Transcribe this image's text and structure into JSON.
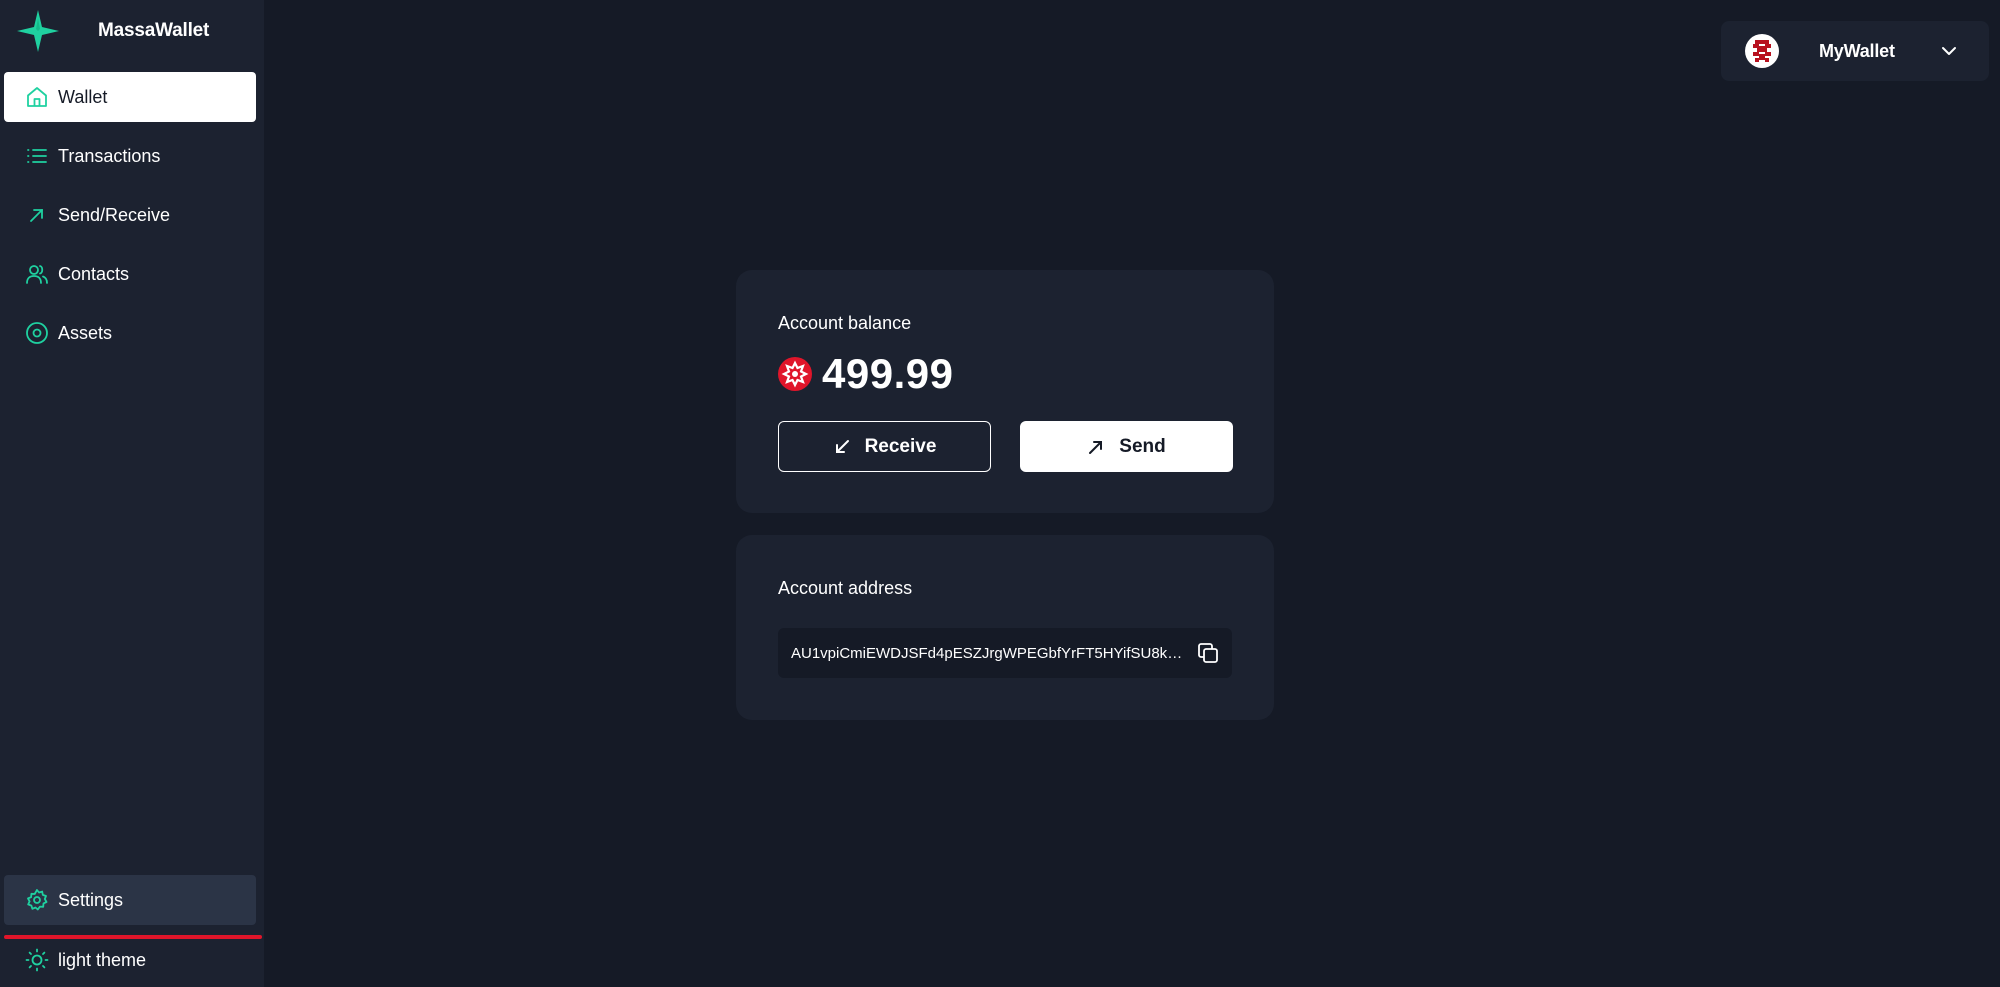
{
  "brand": {
    "name": "MassaWallet",
    "icon": "massa-star-icon",
    "accent": "#1fd1a0"
  },
  "sidebar": {
    "items": [
      {
        "label": "Wallet",
        "icon": "home-icon",
        "active": true
      },
      {
        "label": "Transactions",
        "icon": "list-icon"
      },
      {
        "label": "Send/Receive",
        "icon": "arrow-up-right-icon"
      },
      {
        "label": "Contacts",
        "icon": "users-icon"
      },
      {
        "label": "Assets",
        "icon": "target-icon"
      }
    ],
    "settings_label": "Settings",
    "theme_label": "light theme"
  },
  "account": {
    "name": "MyWallet",
    "avatar": "pixel-avatar-icon"
  },
  "balance": {
    "label": "Account balance",
    "value": "499.99",
    "coin_icon": "massa-coin-icon",
    "receive_label": "Receive",
    "send_label": "Send"
  },
  "address": {
    "label": "Account address",
    "value": "AU1vpiCmiEWDJSFd4pESZJrgWPEGbfYrFT5HYifSU8ko5..."
  },
  "colors": {
    "background": "#151a26",
    "panel": "#1c2230",
    "accent": "#1fd1a0",
    "highlight": "#e0152a"
  }
}
